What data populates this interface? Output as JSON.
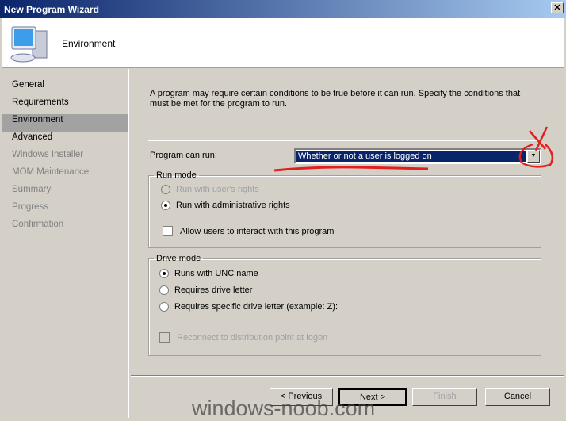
{
  "window": {
    "title": "New Program Wizard",
    "close": "✕"
  },
  "header": {
    "title": "Environment",
    "icon": "computer-icon"
  },
  "sidebar": {
    "items": [
      {
        "label": "General",
        "state": "normal"
      },
      {
        "label": "Requirements",
        "state": "normal"
      },
      {
        "label": "Environment",
        "state": "selected"
      },
      {
        "label": "Advanced",
        "state": "normal"
      },
      {
        "label": "Windows Installer",
        "state": "disabled"
      },
      {
        "label": "MOM Maintenance",
        "state": "disabled"
      },
      {
        "label": "Summary",
        "state": "disabled"
      },
      {
        "label": "Progress",
        "state": "disabled"
      },
      {
        "label": "Confirmation",
        "state": "disabled"
      }
    ]
  },
  "main": {
    "intro": "A program may require certain conditions to be true before it can run. Specify the conditions that must be met for the program to run.",
    "program_can_run_label": "Program can run:",
    "program_can_run_value": "Whether or not a user is logged on",
    "run_mode": {
      "legend": "Run mode",
      "options": [
        {
          "label": "Run with user's rights",
          "checked": false,
          "enabled": false
        },
        {
          "label": "Run with administrative rights",
          "checked": true,
          "enabled": true
        }
      ],
      "allow_interact": {
        "label": "Allow users to interact with this program",
        "checked": false
      }
    },
    "drive_mode": {
      "legend": "Drive mode",
      "options": [
        {
          "label": "Runs with UNC name",
          "checked": true
        },
        {
          "label": "Requires drive letter",
          "checked": false
        },
        {
          "label": "Requires specific drive letter (example: Z):",
          "checked": false
        }
      ],
      "reconnect": {
        "label": "Reconnect to distribution point at logon",
        "checked": false,
        "enabled": false
      }
    }
  },
  "buttons": {
    "previous": "< Previous",
    "next": "Next >",
    "finish": "Finish",
    "cancel": "Cancel"
  },
  "watermark": "windows-noob.com",
  "colors": {
    "annotation": "#e02020",
    "selection": "#0a246a"
  }
}
